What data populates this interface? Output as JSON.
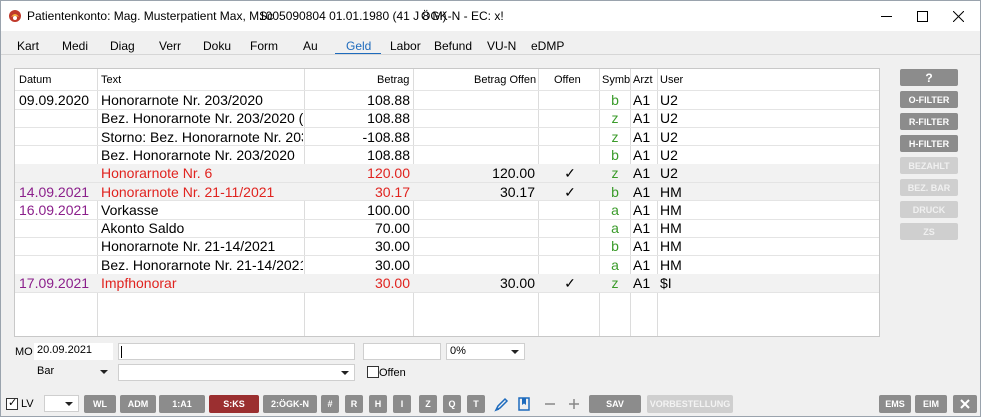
{
  "window": {
    "title": "Patientenkonto: Mag. Musterpatient Max, MSc",
    "patient_info": "1005090804 01.01.1980 (41 J 8 M)",
    "insurance": "ÖGK-N - EC: x!"
  },
  "tabs": [
    {
      "label": "Kart"
    },
    {
      "label": "Medi"
    },
    {
      "label": "Diag"
    },
    {
      "label": "Verr"
    },
    {
      "label": "Doku"
    },
    {
      "label": "Form"
    },
    {
      "label": "Au"
    },
    {
      "label": "Geld",
      "active": true
    },
    {
      "label": "Labor"
    },
    {
      "label": "Befund"
    },
    {
      "label": "VU-N"
    },
    {
      "label": "eDMP"
    }
  ],
  "table": {
    "headers": [
      "Datum",
      "Text",
      "Betrag",
      "Betrag Offen",
      "Offen",
      "Symb",
      "Arzt",
      "User"
    ],
    "rows": [
      {
        "date": "09.09.2020",
        "text": "Honorarnote Nr. 203/2020",
        "betrag": "108.88",
        "offen": "",
        "check": "",
        "symb": "b",
        "arzt": "A1",
        "user": "U2",
        "color": "black"
      },
      {
        "date": "",
        "text": "Bez. Honorarnote Nr. 203/2020 (",
        "betrag": "108.88",
        "offen": "",
        "check": "",
        "symb": "z",
        "arzt": "A1",
        "user": "U2",
        "color": "black"
      },
      {
        "date": "",
        "text": "Storno: Bez. Honorarnote Nr. 203",
        "betrag": "-108.88",
        "offen": "",
        "check": "",
        "symb": "z",
        "arzt": "A1",
        "user": "U2",
        "color": "black"
      },
      {
        "date": "",
        "text": "Bez. Honorarnote Nr. 203/2020",
        "betrag": "108.88",
        "offen": "",
        "check": "",
        "symb": "b",
        "arzt": "A1",
        "user": "U2",
        "color": "black"
      },
      {
        "date": "",
        "text": "Honorarnote Nr. 6",
        "betrag": "120.00",
        "offen": "120.00",
        "check": "✓",
        "symb": "z",
        "arzt": "A1",
        "user": "U2",
        "color": "red"
      },
      {
        "date": "14.09.2021",
        "text": "Honorarnote Nr. 21-11/2021",
        "betrag": "30.17",
        "offen": "30.17",
        "check": "✓",
        "symb": "b",
        "arzt": "A1",
        "user": "HM",
        "color": "red",
        "date_color": "purple"
      },
      {
        "date": "16.09.2021",
        "text": "Vorkasse",
        "betrag": "100.00",
        "offen": "",
        "check": "",
        "symb": "a",
        "arzt": "A1",
        "user": "HM",
        "color": "black",
        "date_color": "purple"
      },
      {
        "date": "",
        "text": "Akonto Saldo",
        "betrag": "70.00",
        "offen": "",
        "check": "",
        "symb": "a",
        "arzt": "A1",
        "user": "HM",
        "color": "black"
      },
      {
        "date": "",
        "text": "Honorarnote Nr. 21-14/2021",
        "betrag": "30.00",
        "offen": "",
        "check": "",
        "symb": "b",
        "arzt": "A1",
        "user": "HM",
        "color": "black"
      },
      {
        "date": "",
        "text": "Bez. Honorarnote Nr. 21-14/2021",
        "betrag": "30.00",
        "offen": "",
        "check": "",
        "symb": "a",
        "arzt": "A1",
        "user": "HM",
        "color": "black"
      },
      {
        "date": "17.09.2021",
        "text": "Impfhonorar",
        "betrag": "30.00",
        "offen": "30.00",
        "check": "✓",
        "symb": "z",
        "arzt": "A1",
        "user": "$I",
        "color": "red",
        "date_color": "purple"
      }
    ]
  },
  "side_buttons": [
    {
      "label": "?",
      "enabled": true
    },
    {
      "label": "O-FILTER",
      "enabled": true
    },
    {
      "label": "R-FILTER",
      "enabled": true
    },
    {
      "label": "H-FILTER",
      "enabled": true
    },
    {
      "label": "BEZAHLT",
      "enabled": false
    },
    {
      "label": "BEZ. BAR",
      "enabled": false
    },
    {
      "label": "DRUCK",
      "enabled": false
    },
    {
      "label": "ZS",
      "enabled": false
    }
  ],
  "form": {
    "weekday": "MO",
    "date": "20.09.2021",
    "text_value": "",
    "amount_value": "",
    "percent": "0%",
    "payment_type": "Bar",
    "note_value": "",
    "offen_label": "Offen"
  },
  "bottom": {
    "lv_label": "LV",
    "lv_select": "",
    "buttons": [
      {
        "label": "WL"
      },
      {
        "label": "ADM"
      },
      {
        "label": "1:A1"
      },
      {
        "label": "S:KS",
        "active": true
      },
      {
        "label": "2:ÖGK-N"
      },
      {
        "label": "#"
      },
      {
        "label": "R"
      },
      {
        "label": "H"
      },
      {
        "label": "I"
      },
      {
        "label": "Z"
      },
      {
        "label": "Q"
      },
      {
        "label": "T"
      }
    ],
    "sav_label": "SAV",
    "vorbestellung_label": "VORBESTELLUNG",
    "ems_label": "EMS",
    "eim_label": "EIM"
  },
  "colors": {
    "tab_active": "#1e6bbd",
    "red_text": "#e0231f",
    "purple_text": "#8b1f8b",
    "green_symb": "#3a9b2a",
    "active_btn": "#9b2f30"
  }
}
